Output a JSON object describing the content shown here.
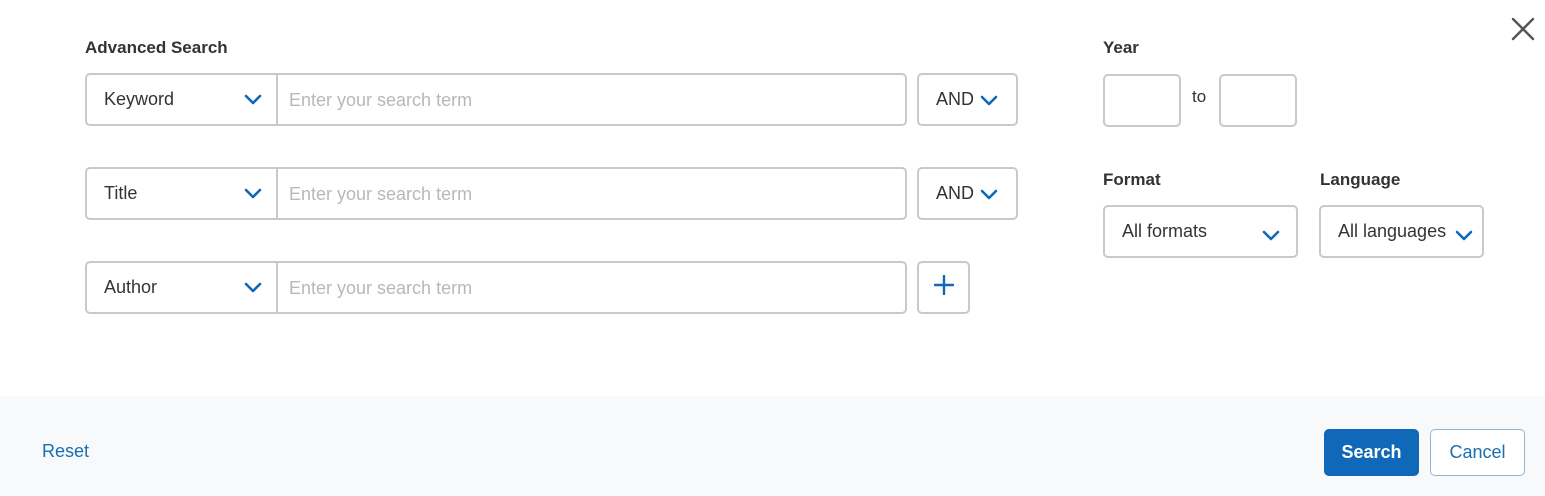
{
  "dialog": {
    "title": "Advanced Search",
    "close_icon": "close-icon"
  },
  "rows": [
    {
      "field": "Keyword",
      "placeholder": "Enter your search term",
      "operator": "AND"
    },
    {
      "field": "Title",
      "placeholder": "Enter your search term",
      "operator": "AND"
    },
    {
      "field": "Author",
      "placeholder": "Enter your search term",
      "add_icon": "plus-icon"
    }
  ],
  "year": {
    "label": "Year",
    "to_label": "to",
    "from_value": "",
    "to_value": ""
  },
  "format": {
    "label": "Format",
    "selected": "All formats"
  },
  "language": {
    "label": "Language",
    "selected": "All languages"
  },
  "footer": {
    "reset_label": "Reset",
    "search_label": "Search",
    "cancel_label": "Cancel"
  },
  "colors": {
    "accent": "#1068b8",
    "link": "#1a6fb0",
    "border": "#c9c9c9",
    "footer_bg": "#f7f9fb"
  }
}
